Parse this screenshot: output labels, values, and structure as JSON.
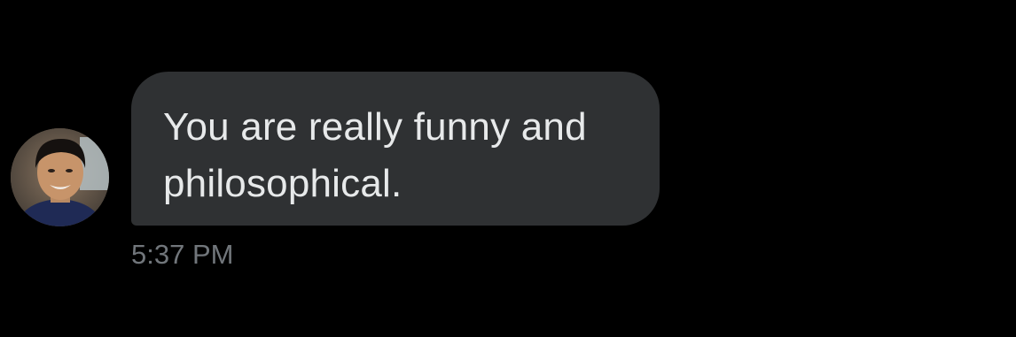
{
  "message": {
    "text": "You are really funny and philosophical.",
    "timestamp": "5:37 PM"
  },
  "sender": {
    "avatar_icon": "user-avatar-photo"
  },
  "colors": {
    "background": "#000000",
    "bubble": "#2f3133",
    "text": "#e7e9ea",
    "timestamp": "#71767b"
  }
}
